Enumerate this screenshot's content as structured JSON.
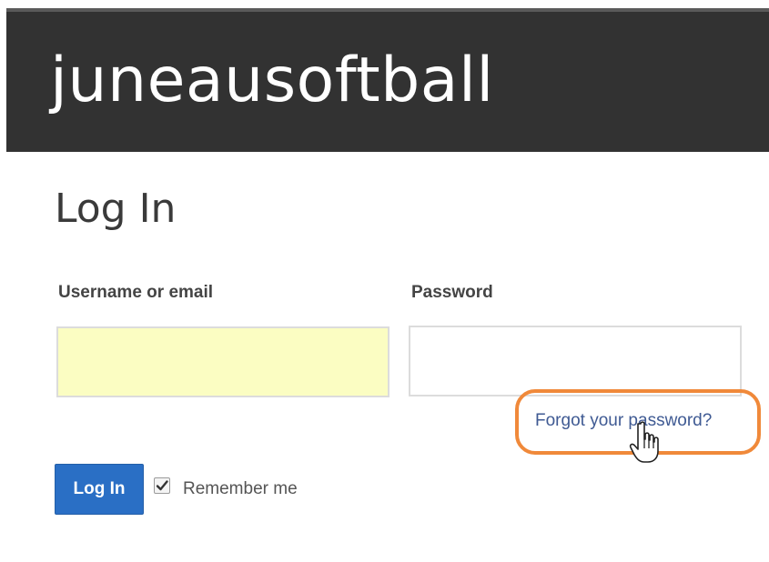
{
  "header": {
    "site_title": "juneausoftball"
  },
  "main": {
    "page_title": "Log In",
    "username": {
      "label": "Username or email",
      "value": ""
    },
    "password": {
      "label": "Password",
      "value": ""
    },
    "forgot_password_link": "Forgot your password?",
    "login_button": "Log In",
    "remember_me": {
      "label": "Remember me",
      "checked": true
    }
  },
  "colors": {
    "header_background": "#323232",
    "username_autofill_background": "#fbfdc2",
    "login_button": "#2a6fc5",
    "link": "#3f5a93",
    "highlight_outline": "#f0893a"
  },
  "icons": {
    "cursor": "hand-pointer-icon",
    "checkbox_mark": "checkmark-icon"
  }
}
